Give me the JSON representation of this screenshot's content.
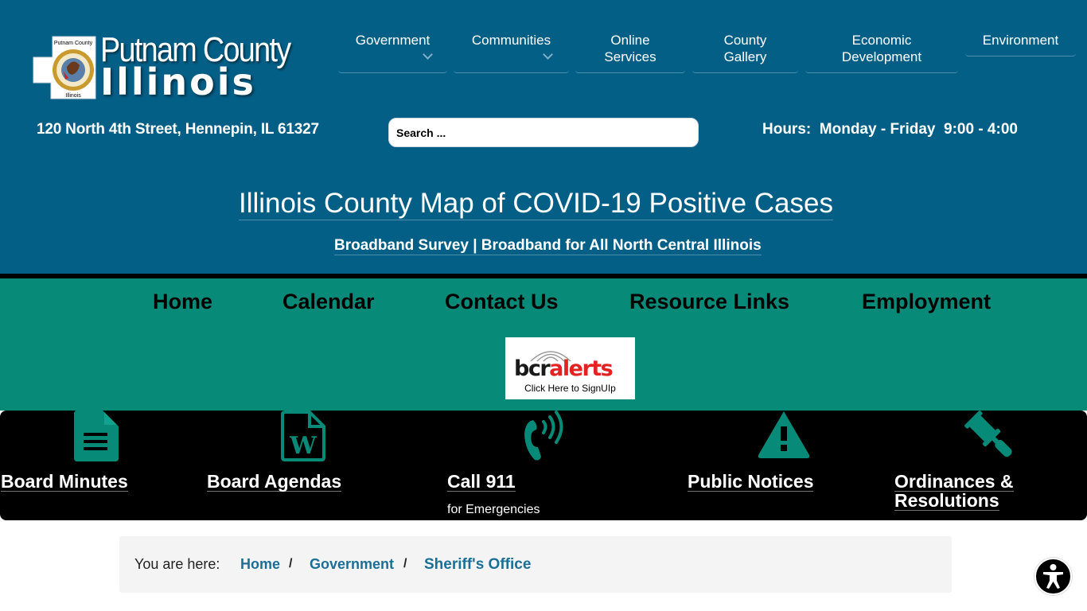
{
  "logo": {
    "line1": "Putnam County",
    "line2": "Illinois",
    "seal_caption_top": "Putnam County",
    "seal_caption_bottom": "Illinois"
  },
  "top_nav": {
    "items": [
      {
        "label": "Government",
        "has_dropdown": true
      },
      {
        "label": "Communities",
        "has_dropdown": true
      },
      {
        "label": "Online Services",
        "has_dropdown": false
      },
      {
        "label": "County Gallery",
        "has_dropdown": false
      },
      {
        "label": "Economic Development",
        "has_dropdown": false
      },
      {
        "label": "Environment",
        "has_dropdown": false
      }
    ]
  },
  "info": {
    "address": "120 North 4th Street, Hennepin, IL 61327",
    "hours": "Hours:  Monday - Friday  9:00 - 4:00"
  },
  "search": {
    "placeholder": "Search ...",
    "value": ""
  },
  "announcements": {
    "covid_link": "Illinois County Map of COVID-19 Positive Cases",
    "broadband_link": "Broadband Survey | Broadband for All North Central Illinois"
  },
  "main_nav": {
    "items": [
      "Home",
      "Calendar",
      "Contact Us",
      "Resource Links",
      "Employment"
    ]
  },
  "bcr_alerts": {
    "brand_dark": "bcr",
    "brand_red": "alerts",
    "caption": "Click Here to SignUIp"
  },
  "quick_links": {
    "items": [
      {
        "label": "Board Minutes",
        "icon": "document-icon",
        "sub": ""
      },
      {
        "label": "Board Agendas",
        "icon": "word-document-icon",
        "sub": ""
      },
      {
        "label": "Call 911",
        "icon": "phone-volume-icon",
        "sub": "for Emergencies"
      },
      {
        "label": "Public Notices",
        "icon": "warning-icon",
        "sub": ""
      },
      {
        "label": "Ordinances & Resolutions",
        "label_line1": "Ordinances &",
        "label_line2": "Resolutions",
        "icon": "gavel-icon",
        "sub": ""
      }
    ]
  },
  "breadcrumb": {
    "lead": "You are here:",
    "items": [
      "Home",
      "Government"
    ],
    "separator": "/",
    "current": "Sheriff's Office"
  },
  "colors": {
    "header_blue": "#045f87",
    "teal": "#078a77",
    "link_blue": "#1b6f96",
    "black": "#000000"
  },
  "accessibility_widget": {
    "icon": "accessibility-icon"
  }
}
